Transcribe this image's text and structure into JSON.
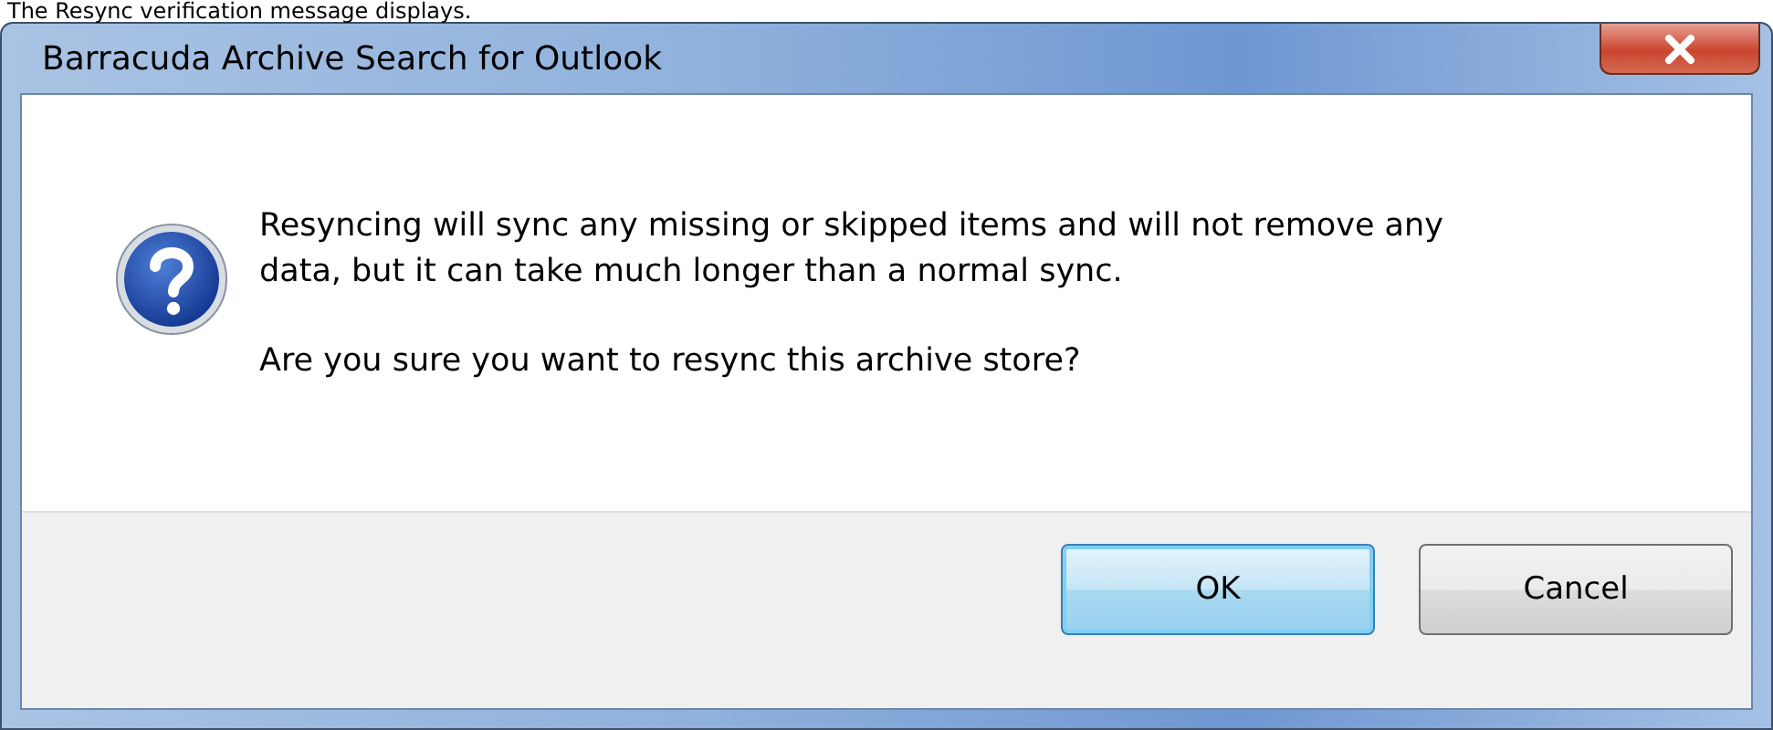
{
  "caption": "The Resync verification message displays.",
  "window": {
    "title": "Barracuda Archive Search for Outlook"
  },
  "message": {
    "kind": "question",
    "paragraphs": [
      "Resyncing will sync any missing or skipped items and will not remove any data, but it can take much longer than a normal sync.",
      "Are you sure you want to resync this archive store?"
    ]
  },
  "buttons": [
    {
      "label": "OK",
      "default": true
    },
    {
      "label": "Cancel",
      "default": false
    }
  ]
}
